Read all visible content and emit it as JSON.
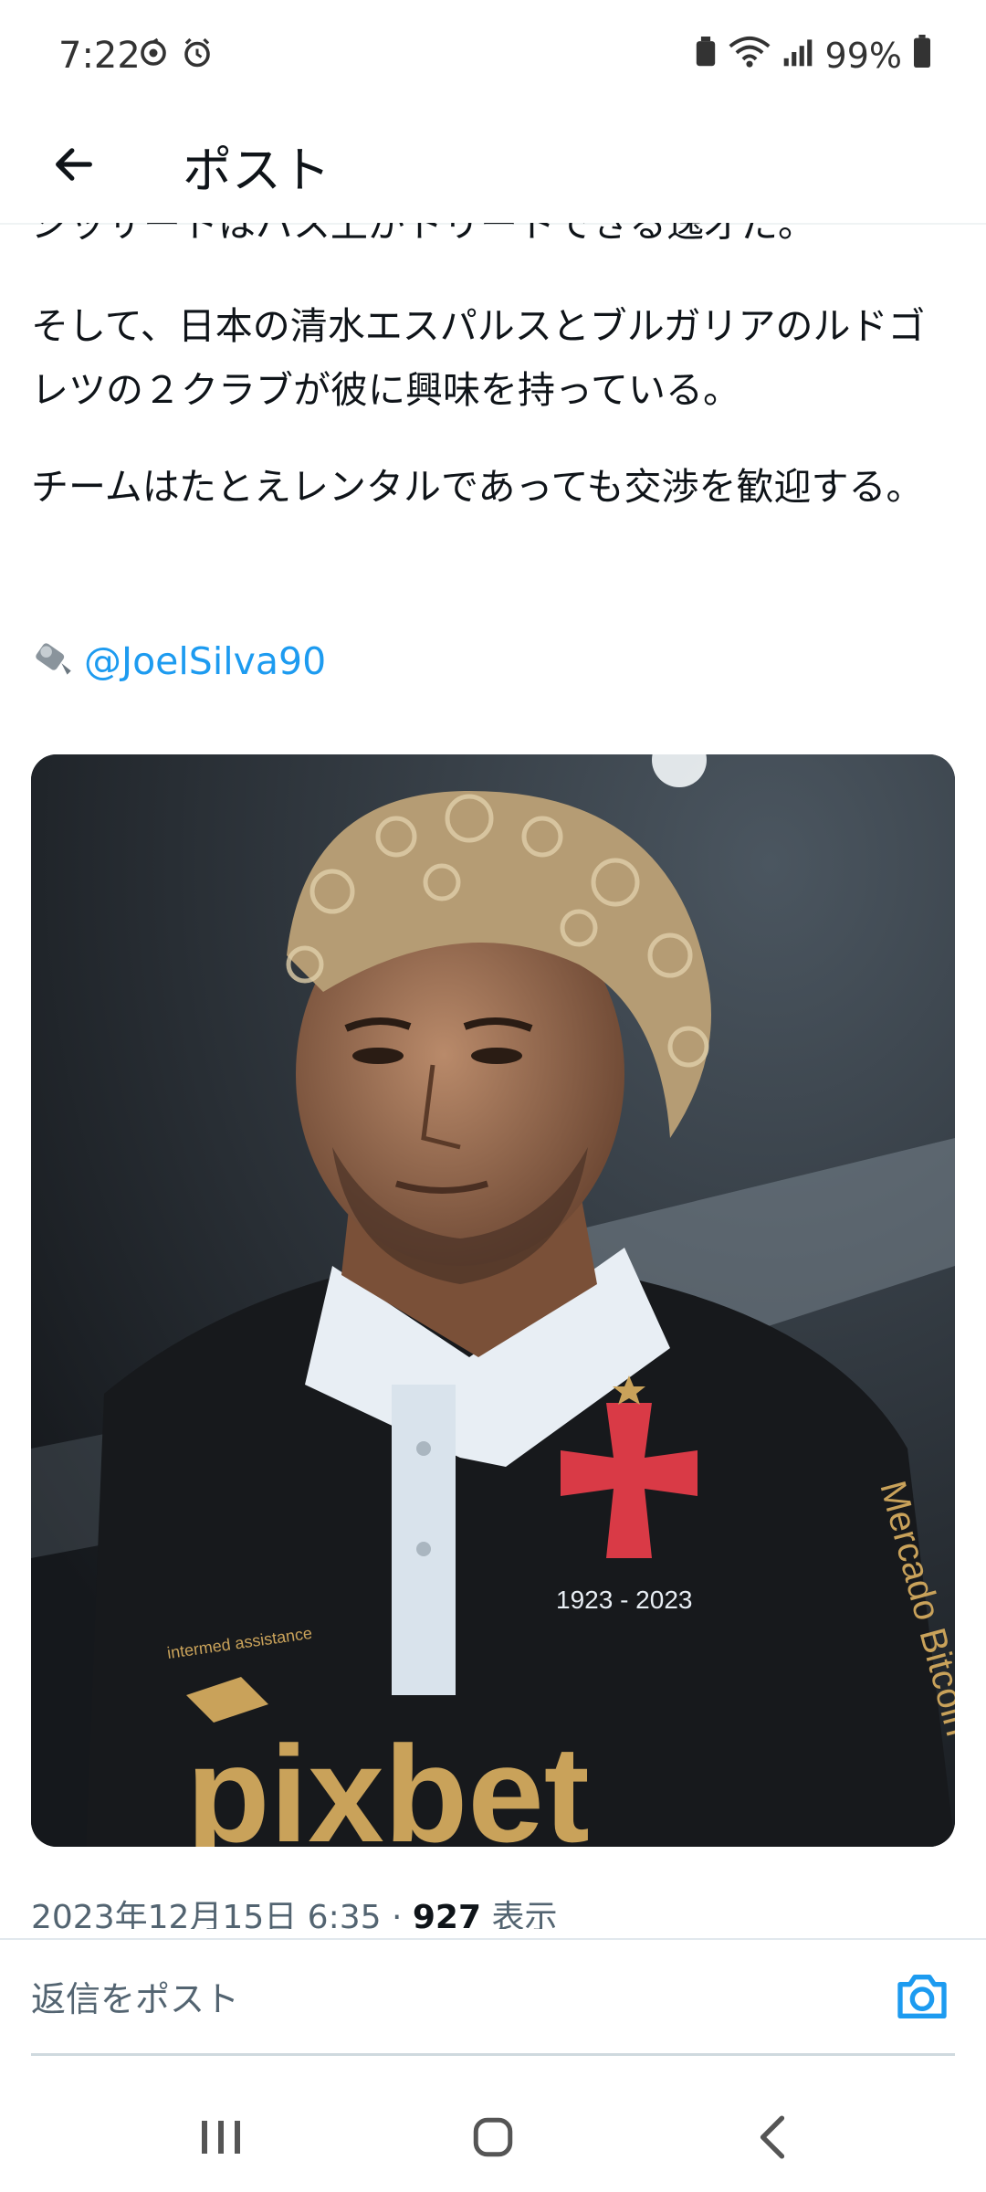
{
  "status_bar": {
    "time": "7:22",
    "battery": "99%",
    "left_icons": [
      "sync-icon",
      "alarm-icon"
    ],
    "right_icons": [
      "battery-saver-icon",
      "wifi-icon",
      "signal-icon",
      "battery-icon"
    ]
  },
  "header": {
    "title": "ポスト",
    "back_icon": "back-arrow-icon"
  },
  "post": {
    "clipped_text": "ジッサートはバス上がトリートできる逸才だ。",
    "paragraphs": [
      "そして、日本の清水エスパルスとブルガリアのルドゴレツの２クラブが彼に興味を持っている。",
      "チームはたとえレンタルであっても交渉を歓迎する。"
    ],
    "source_icon": "video-camera-emoji-icon",
    "mention": "@JoelSilva90",
    "image": {
      "description_icon": "player-photo",
      "jersey_text": [
        "1923 - 2023",
        "intermed assistance",
        "pixbet",
        "Mercado Bitcoin"
      ]
    },
    "timestamp": "2023年12月15日 6:35",
    "separator": " · ",
    "views_count": "927",
    "views_label": " 表示"
  },
  "reply": {
    "placeholder": "返信をポスト",
    "camera_icon": "camera-icon"
  },
  "nav": {
    "icons": [
      "recents-icon",
      "home-icon",
      "back-icon"
    ]
  },
  "colors": {
    "accent": "#1d9bf0",
    "text": "#0f1419",
    "secondary": "#536471"
  }
}
